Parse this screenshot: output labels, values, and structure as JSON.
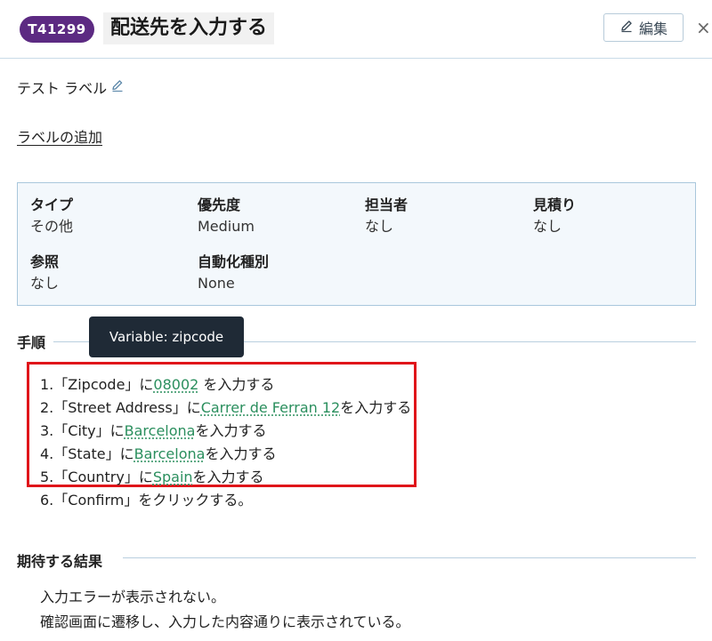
{
  "header": {
    "ticket_id": "T41299",
    "title": "配送先を入力する",
    "edit_label": "編集",
    "close_glyph": "×"
  },
  "labels": {
    "test_label": "テスト ラベル",
    "add_label": "ラベルの追加"
  },
  "info": {
    "type_label": "タイプ",
    "type_value": "その他",
    "priority_label": "優先度",
    "priority_value": "Medium",
    "assignee_label": "担当者",
    "assignee_value": "なし",
    "estimate_label": "見積り",
    "estimate_value": "なし",
    "reference_label": "参照",
    "reference_value": "なし",
    "automation_label": "自動化種別",
    "automation_value": "None"
  },
  "steps": {
    "heading": "手順",
    "tooltip": "Variable: zipcode",
    "items": [
      {
        "prefix": "1.「Zipcode」に",
        "variable": "08002",
        "suffix": " を入力する"
      },
      {
        "prefix": "2.「Street Address」に",
        "variable": "Carrer de Ferran 12",
        "suffix": "を入力する"
      },
      {
        "prefix": "3.「City」に",
        "variable": "Barcelona",
        "suffix": "を入力する"
      },
      {
        "prefix": "4.「State」に",
        "variable": "Barcelona",
        "suffix": "を入力する"
      },
      {
        "prefix": "5.「Country」に",
        "variable": "Spain",
        "suffix": "を入力する"
      },
      {
        "prefix": "6.「Confirm」をクリックする。",
        "variable": "",
        "suffix": ""
      }
    ]
  },
  "expected": {
    "heading": "期待する結果",
    "lines": [
      "入力エラーが表示されない。",
      "確認画面に遷移し、入力した内容通りに表示されている。"
    ]
  },
  "colors": {
    "badge": "#5c2a82",
    "variable_link": "#2b8f5e",
    "highlight_border": "#e0151a",
    "tooltip_bg": "#1f2a36"
  },
  "icons": {
    "edit": "pencil-icon",
    "label_edit": "pencil-icon",
    "close": "close-icon"
  }
}
